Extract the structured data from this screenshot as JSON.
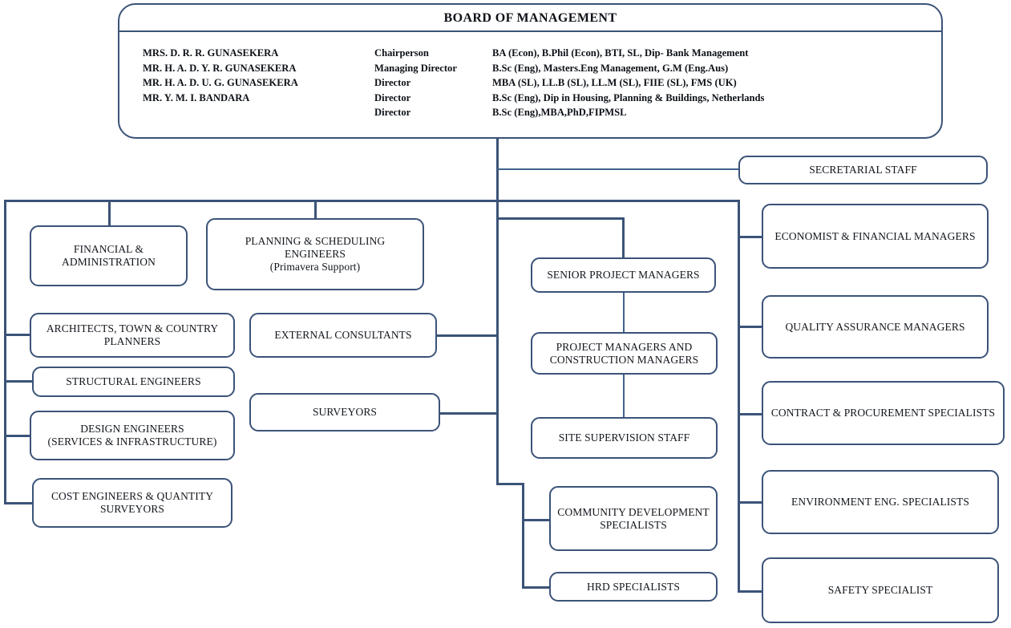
{
  "board": {
    "title": "BOARD OF MANAGEMENT",
    "members": [
      {
        "name": "MRS. D. R. R. GUNASEKERA",
        "title": "Chairperson",
        "qualifications": "BA (Econ), B.Phil (Econ), BTI, SL, Dip- Bank Management"
      },
      {
        "name": "MR. H. A. D. Y. R. GUNASEKERA",
        "title": "Managing Director",
        "qualifications": "B.Sc (Eng),  Masters.Eng Management, G.M (Eng.Aus)"
      },
      {
        "name": "MR. H. A. D. U. G. GUNASEKERA",
        "title": "Director",
        "qualifications": "MBA (SL), LL.B (SL), LL.M (SL), FIIE (SL), FMS (UK)"
      },
      {
        "name": "MR. Y. M. I. BANDARA",
        "title": "Director",
        "qualifications": "B.Sc (Eng), Dip in Housing, Planning & Buildings, Netherlands"
      },
      {
        "name": "",
        "title": "Director",
        "qualifications": "B.Sc (Eng),MBA,PhD,FIPMSL"
      }
    ]
  },
  "nodes": {
    "secretarial_staff": "SECRETARIAL STAFF",
    "financial_administration_line1": "FINANCIAL &",
    "financial_administration_line2": "ADMINISTRATION",
    "planning_scheduling_line1": "PLANNING & SCHEDULING ENGINEERS",
    "planning_scheduling_line2": "(Primavera Support)",
    "architects_line1": "ARCHITECTS, TOWN & COUNTRY",
    "architects_line2": "PLANNERS",
    "structural_engineers": "STRUCTURAL ENGINEERS",
    "design_engineers_line1": "DESIGN ENGINEERS",
    "design_engineers_line2": "(SERVICES & INFRASTRUCTURE)",
    "cost_engineers_line1": "COST ENGINEERS & QUANTITY",
    "cost_engineers_line2": "SURVEYORS",
    "external_consultants": "EXTERNAL CONSULTANTS",
    "surveyors": "SURVEYORS",
    "senior_project_managers": "SENIOR PROJECT MANAGERS",
    "project_managers_line1": "PROJECT MANAGERS  AND",
    "project_managers_line2": "CONSTRUCTION MANAGERS",
    "site_supervision_staff": "SITE SUPERVISION STAFF",
    "community_development_line1": "COMMUNITY DEVELOPMENT",
    "community_development_line2": "SPECIALISTS",
    "hrd_specialists": "HRD SPECIALISTS",
    "economist_financial_managers": "ECONOMIST & FINANCIAL MANAGERS",
    "quality_assurance_managers": "QUALITY ASSURANCE MANAGERS",
    "contract_procurement_specialists": "CONTRACT & PROCUREMENT SPECIALISTS",
    "environment_eng_specialists": "ENVIRONMENT ENG. SPECIALISTS",
    "safety_specialist": "SAFETY SPECIALIST"
  },
  "colors": {
    "line": "#3b5378",
    "border": "#3b5378",
    "background": "#ffffff",
    "text": "#12161c"
  }
}
